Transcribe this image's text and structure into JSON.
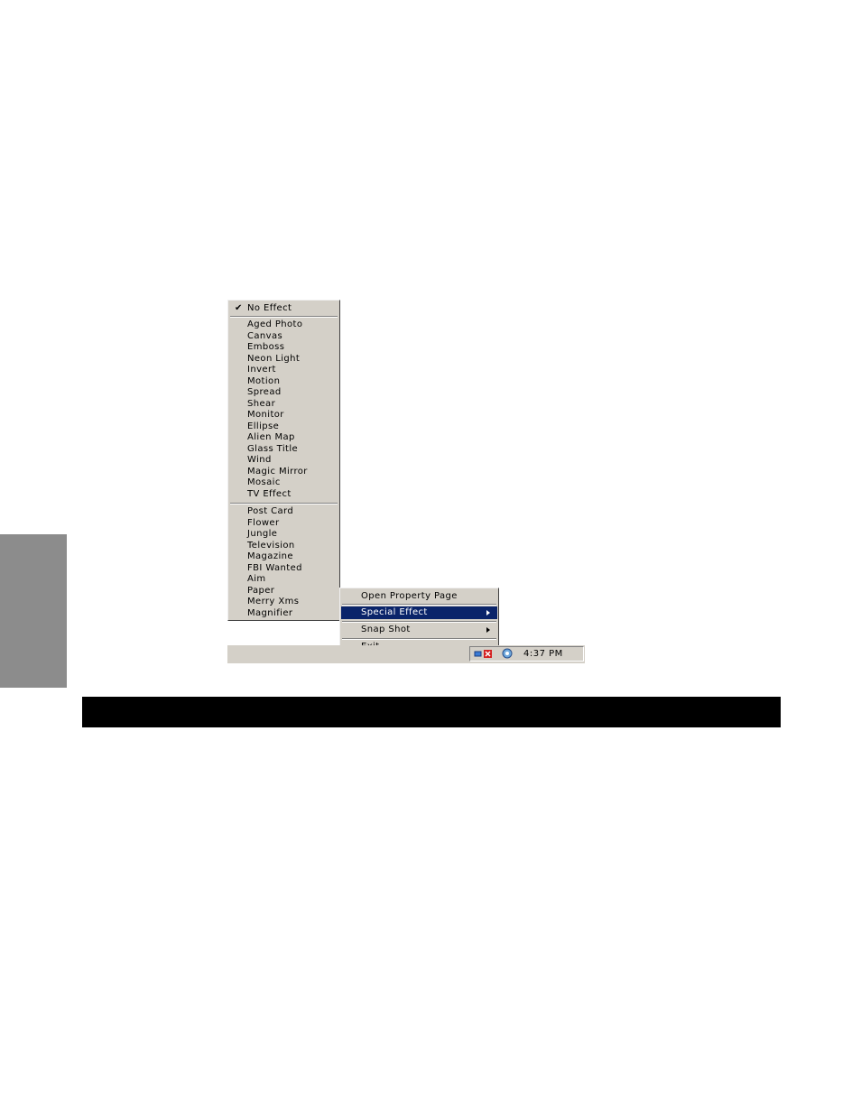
{
  "effects_menu": {
    "checked_item": "No Effect",
    "group1": [
      "Aged Photo",
      "Canvas",
      "Emboss",
      "Neon Light",
      "Invert",
      "Motion",
      "Spread",
      "Shear",
      "Monitor",
      "Ellipse",
      "Alien Map",
      "Glass Title",
      "Wind",
      "Magic Mirror",
      "Mosaic",
      "TV Effect"
    ],
    "group2": [
      "Post Card",
      "Flower",
      "Jungle",
      "Television",
      "Magazine",
      "FBI Wanted",
      "Aim",
      "Paper",
      "Merry Xms",
      "Magnifier"
    ]
  },
  "tray_menu": {
    "open_property_page": "Open Property Page",
    "special_effect": "Special Effect",
    "snap_shot": "Snap Shot",
    "exit": "Exit"
  },
  "taskbar": {
    "time": "4:37 PM",
    "tray_icons": [
      "network-icon",
      "close-x-icon",
      "camera-app-icon"
    ]
  },
  "colors": {
    "menu_bg": "#d4d0c8",
    "highlight": "#0a246a",
    "side_tab": "#8c8c8c",
    "banner": "#000000"
  }
}
